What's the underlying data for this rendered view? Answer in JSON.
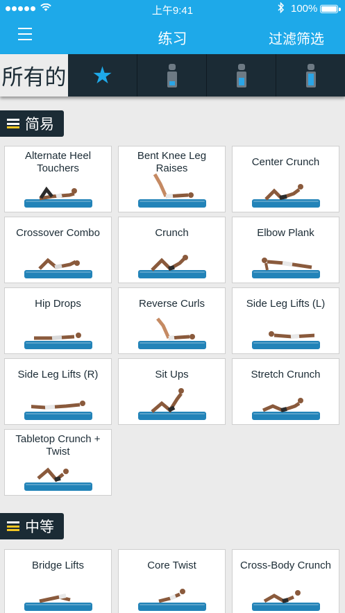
{
  "status_bar": {
    "carrier_dots": 5,
    "wifi_icon": "wifi-icon",
    "time": "上午9:41",
    "bluetooth_icon": "bluetooth-icon",
    "battery_percent": "100%",
    "battery_level": 1.0
  },
  "nav": {
    "menu_icon": "hamburger-menu-icon",
    "title": "练习",
    "filter_label": "过滤筛选"
  },
  "tabs": {
    "all_label": "所有的",
    "items": [
      {
        "icon": "star-icon",
        "color": "#1ea9e9"
      },
      {
        "icon": "level-beginner-icon",
        "fill": 0.33
      },
      {
        "icon": "level-intermediate-icon",
        "fill": 0.66
      },
      {
        "icon": "level-advanced-icon",
        "fill": 1.0
      }
    ]
  },
  "sections": [
    {
      "title": "简易",
      "level_bars_on": 1,
      "exercises": [
        {
          "name": "Alternate Heel Touchers"
        },
        {
          "name": "Bent Knee Leg Raises"
        },
        {
          "name": "Center Crunch"
        },
        {
          "name": "Crossover Combo"
        },
        {
          "name": "Crunch"
        },
        {
          "name": "Elbow Plank"
        },
        {
          "name": "Hip Drops"
        },
        {
          "name": "Reverse Curls"
        },
        {
          "name": "Side Leg Lifts (L)"
        },
        {
          "name": "Side Leg Lifts (R)"
        },
        {
          "name": "Sit Ups"
        },
        {
          "name": "Stretch Crunch"
        },
        {
          "name": "Tabletop Crunch + Twist"
        }
      ]
    },
    {
      "title": "中等",
      "level_bars_on": 2,
      "exercises": [
        {
          "name": "Bridge Lifts"
        },
        {
          "name": "Core Twist"
        },
        {
          "name": "Cross-Body Crunch"
        }
      ]
    }
  ],
  "colors": {
    "accent": "#1ea9e9",
    "dark_bar": "#1b2b35",
    "mat": "#2283b8",
    "level_on": "#f3c623"
  }
}
